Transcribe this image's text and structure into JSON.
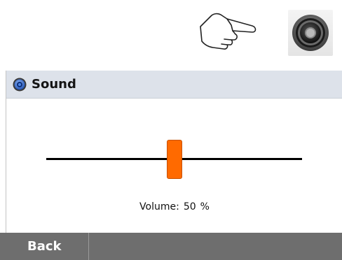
{
  "top_icons": {
    "pointer": "hand-pointer-icon",
    "speaker": "speaker-icon"
  },
  "panel": {
    "icon": "speaker-small-icon",
    "title": "Sound"
  },
  "volume": {
    "label": "Volume:",
    "value": "50",
    "unit": "%",
    "fraction": 0.5
  },
  "footer": {
    "back_label": "Back"
  },
  "colors": {
    "header_bg": "#dde2ea",
    "thumb": "#ff6a00",
    "footer_bg": "#6e6e6e"
  }
}
